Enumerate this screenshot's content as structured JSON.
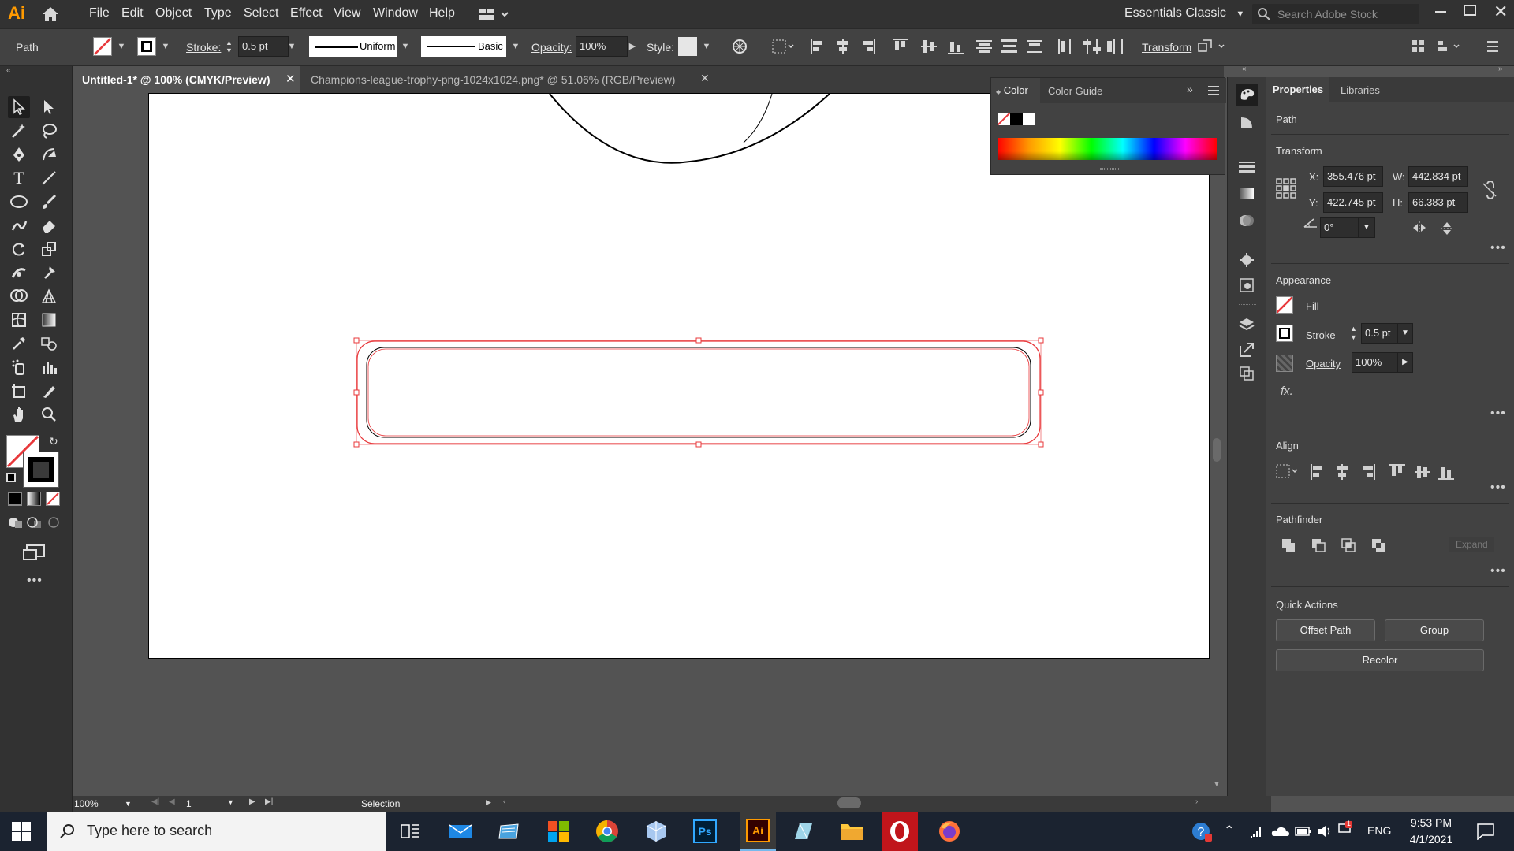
{
  "app": {
    "logo": "Ai"
  },
  "menubar": {
    "items": [
      "File",
      "Edit",
      "Object",
      "Type",
      "Select",
      "Effect",
      "View",
      "Window",
      "Help"
    ],
    "workspace": "Essentials Classic",
    "search_placeholder": "Search Adobe Stock"
  },
  "controlbar": {
    "selection_type": "Path",
    "stroke_label": "Stroke:",
    "stroke_value": "0.5 pt",
    "profile_value": "Uniform",
    "brush_value": "Basic",
    "opacity_label": "Opacity:",
    "opacity_value": "100%",
    "style_label": "Style:",
    "transform_label": "Transform"
  },
  "tabs": [
    {
      "label": "Untitled-1* @ 100% (CMYK/Preview)",
      "active": true
    },
    {
      "label": "Champions-league-trophy-png-1024x1024.png* @ 51.06% (RGB/Preview)",
      "active": false
    }
  ],
  "color_panel": {
    "tabs": [
      "Color",
      "Color Guide"
    ]
  },
  "properties": {
    "tabs": [
      "Properties",
      "Libraries"
    ],
    "object_type": "Path",
    "transform": {
      "title": "Transform",
      "x_label": "X:",
      "x": "355.476 pt",
      "y_label": "Y:",
      "y": "422.745 pt",
      "w_label": "W:",
      "w": "442.834 pt",
      "h_label": "H:",
      "h": "66.383 pt",
      "angle": "0°"
    },
    "appearance": {
      "title": "Appearance",
      "fill_label": "Fill",
      "stroke_label": "Stroke",
      "stroke_value": "0.5 pt",
      "opacity_label": "Opacity",
      "opacity_value": "100%",
      "fx_label": "fx."
    },
    "align": {
      "title": "Align"
    },
    "pathfinder": {
      "title": "Pathfinder",
      "expand_label": "Expand"
    },
    "quick_actions": {
      "title": "Quick Actions",
      "offset_path": "Offset Path",
      "group": "Group",
      "recolor": "Recolor"
    }
  },
  "statusbar": {
    "zoom": "100%",
    "artboard_number": "1",
    "tool_name": "Selection"
  },
  "taskbar": {
    "search_placeholder": "Type here to search",
    "language": "ENG",
    "time": "9:53 PM",
    "date": "4/1/2021",
    "notification_badge": "1"
  },
  "colors": {
    "selection_red": "#e8383b",
    "ui_dark": "#323232",
    "ui_mid": "#424242",
    "canvas_bg": "#535353",
    "artboard": "#ffffff",
    "taskbar": "#1b2330"
  }
}
